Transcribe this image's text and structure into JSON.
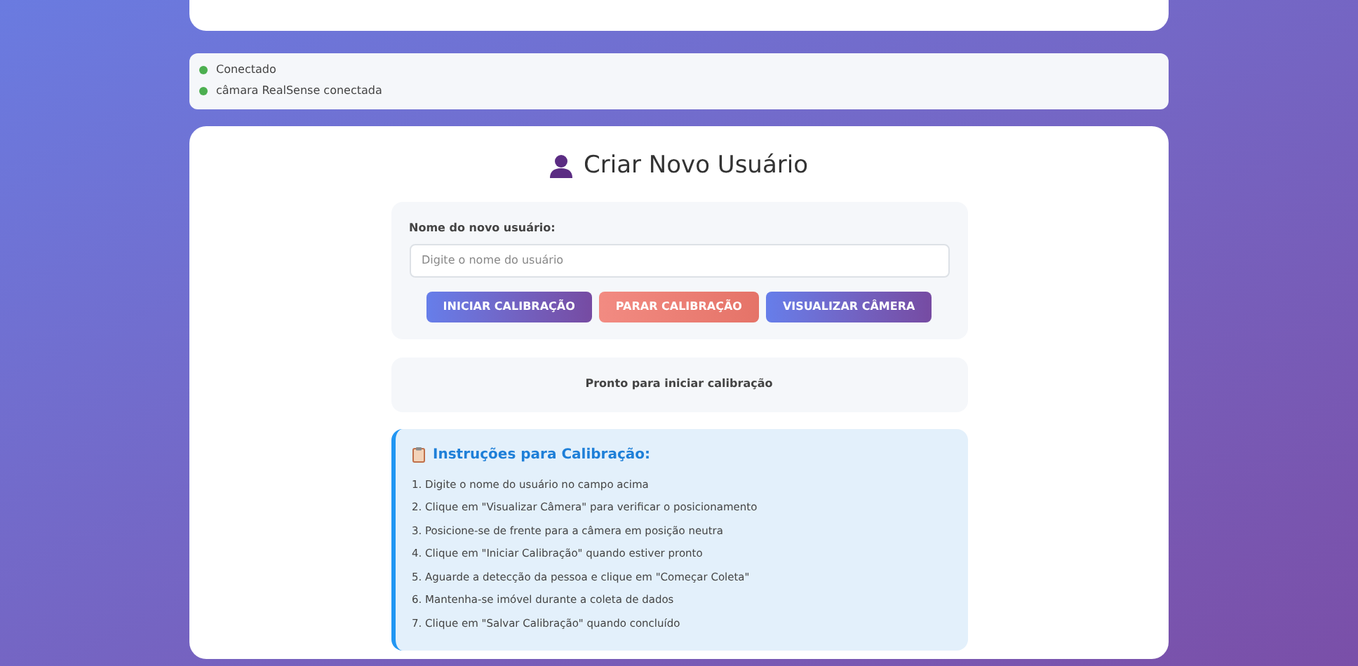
{
  "status": [
    {
      "text": "Conectado",
      "color": "#4caf50"
    },
    {
      "text": "câmara RealSense conectada",
      "color": "#4caf50"
    }
  ],
  "title": "Criar Novo Usuário",
  "form": {
    "label": "Nome do novo usuário:",
    "placeholder": "Digite o nome do usuário",
    "buttons": [
      {
        "label": "INICIAR CALIBRAÇÃO",
        "kind": "primary"
      },
      {
        "label": "PARAR CALIBRAÇÃO",
        "kind": "danger"
      },
      {
        "label": "VISUALIZAR CÂMERA",
        "kind": "primary"
      }
    ]
  },
  "message": "Pronto para iniciar calibração",
  "instructions": {
    "title": "Instruções para Calibração:",
    "items": [
      "1. Digite o nome do usuário no campo acima",
      "2. Clique em \"Visualizar Câmera\" para verificar o posicionamento",
      "3. Posicione-se de frente para a câmera em posição neutra",
      "4. Clique em \"Iniciar Calibração\" quando estiver pronto",
      "5. Aguarde a detecção da pessoa e clique em \"Começar Coleta\"",
      "6. Mantenha-se imóvel durante a coleta de dados",
      "7. Clique em \"Salvar Calibração\" quando concluído"
    ]
  }
}
